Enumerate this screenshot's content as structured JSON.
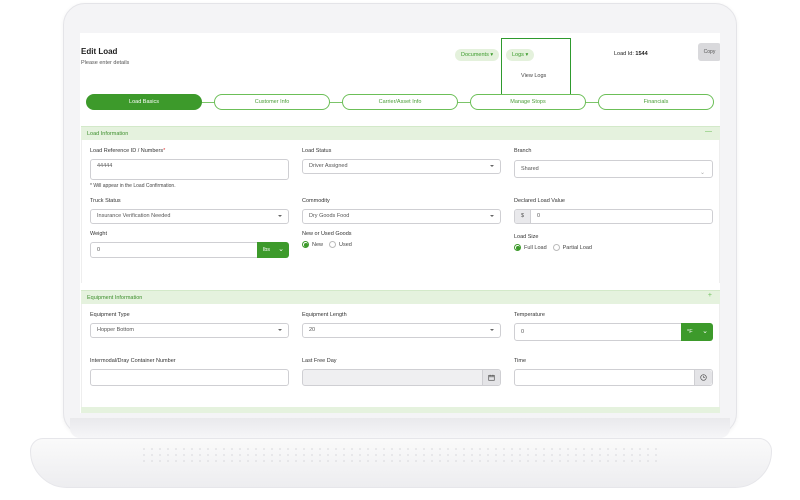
{
  "header": {
    "title": "Edit Load",
    "subtitle": "Please enter details",
    "documents_label": "Documents",
    "logs_label": "Logs",
    "logs_menu_item": "View Logs",
    "load_id_label": "Load Id:",
    "load_id_value": "1544",
    "copy_label": "Copy"
  },
  "stepper": {
    "steps": [
      {
        "label": "Load Basics",
        "active": true
      },
      {
        "label": "Customer Info",
        "active": false
      },
      {
        "label": "Carrier/Asset Info",
        "active": false
      },
      {
        "label": "Manage Stops",
        "active": false
      },
      {
        "label": "Financials",
        "active": false
      }
    ]
  },
  "load_info": {
    "section_title": "Load Information",
    "toggle": "—",
    "ref_label": "Load Reference ID / Numbers",
    "ref_required": "*",
    "ref_value": "44444",
    "ref_hint": "* Will appear in the Load Confirmation.",
    "status_label": "Load Status",
    "status_value": "Driver Assigned",
    "branch_label": "Branch",
    "branch_value": "Shared",
    "truck_status_label": "Truck Status",
    "truck_status_value": "Insurance Verification Needed",
    "commodity_label": "Commodity",
    "commodity_value": "Dry Goods Food",
    "declared_label": "Declared Load Value",
    "declared_prefix": "$",
    "declared_value": "0",
    "weight_label": "Weight",
    "weight_value": "0",
    "weight_unit": "lbs",
    "goods_label": "New or Used Goods",
    "goods_new": "New",
    "goods_used": "Used",
    "size_label": "Load Size",
    "size_full": "Full Load",
    "size_partial": "Partial Load"
  },
  "equipment": {
    "section_title": "Equipment Information",
    "toggle": "+",
    "type_label": "Equipment Type",
    "type_value": "Hopper Bottom",
    "length_label": "Equipment Length",
    "length_value": "20",
    "temp_label": "Temperature",
    "temp_value": "0",
    "temp_unit": "°F",
    "container_label": "Intermodal/Dray Container Number",
    "container_value": "",
    "free_day_label": "Last Free Day",
    "time_label": "Time"
  },
  "icons": {
    "calendar": "calendar-icon",
    "clock": "clock-icon",
    "chevron": "chevron-down-icon"
  },
  "colors": {
    "accent": "#3d9a2b",
    "accent_light": "#e5f2de",
    "highlight_outline": "#2e9a2e"
  }
}
